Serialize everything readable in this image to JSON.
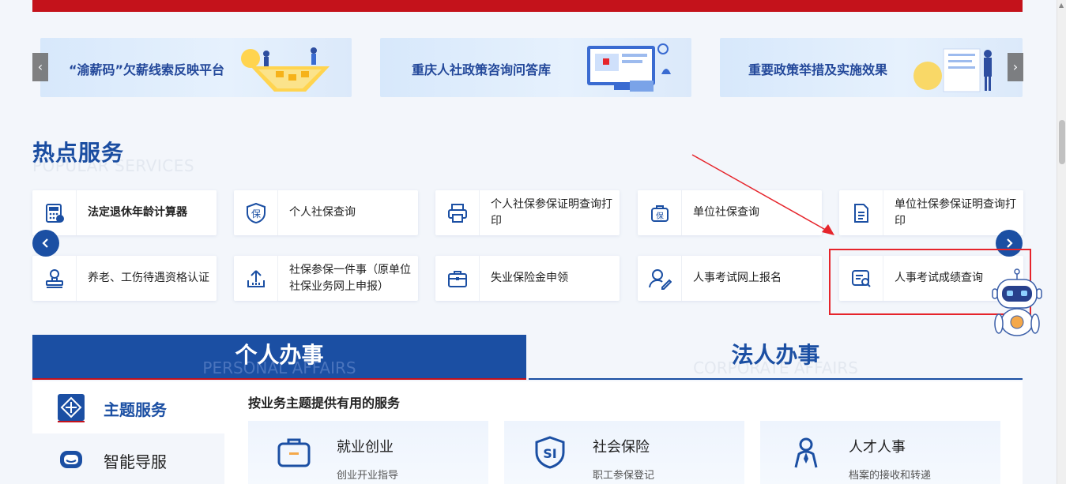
{
  "banners": [
    {
      "text": "“渝薪码”欠薪线索反映平台"
    },
    {
      "text": "重庆人社政策咨询问答库"
    },
    {
      "text": "重要政策举措及实施效果"
    }
  ],
  "carousel": {
    "prev_icon": "‹",
    "next_icon": "›"
  },
  "hot_services": {
    "title": "热点服务",
    "subtitle": "POPULAR SERVICES",
    "row1": [
      {
        "label": "法定退休年龄计算器",
        "icon": "calculator-icon"
      },
      {
        "label": "个人社保查询",
        "icon": "shield-bao-icon"
      },
      {
        "label": "个人社保参保证明查询打印",
        "icon": "printer-icon"
      },
      {
        "label": "单位社保查询",
        "icon": "bag-bao-icon"
      },
      {
        "label": "单位社保参保证明查询打印",
        "icon": "document-icon"
      }
    ],
    "row2": [
      {
        "label": "养老、工伤待遇资格认证",
        "icon": "stamp-icon"
      },
      {
        "label": "社保参保一件事（原单位社保业务网上申报）",
        "icon": "upload-icon"
      },
      {
        "label": "失业保险金申领",
        "icon": "briefcase-icon"
      },
      {
        "label": "人事考试网上报名",
        "icon": "user-edit-icon"
      },
      {
        "label": "人事考试成绩查询",
        "icon": "search-doc-icon"
      }
    ],
    "bao_char": "保"
  },
  "tabs": {
    "personal": {
      "title": "个人办事",
      "subtitle": "PERSONAL AFFAIRS"
    },
    "corporate": {
      "title": "法人办事",
      "subtitle": "CORPORATE AFFAIRS"
    }
  },
  "side_nav": [
    {
      "label": "主题服务",
      "icon": "diamond-arrows-icon"
    },
    {
      "label": "智能导服",
      "icon": "robot-chat-icon"
    }
  ],
  "topics": {
    "heading": "按业务主题提供有用的服务",
    "cards": [
      {
        "title": "就业创业",
        "sub": "创业开业指导",
        "icon": "briefcase-icon"
      },
      {
        "title": "社会保险",
        "sub": "职工参保登记",
        "icon": "si-shield-icon",
        "badge": "SI"
      },
      {
        "title": "人才人事",
        "sub": "档案的接收和转递",
        "icon": "person-icon"
      }
    ]
  },
  "colors": {
    "brand": "#1b4fa3",
    "accent_red": "#c4121b",
    "highlight": "#e6242b"
  }
}
